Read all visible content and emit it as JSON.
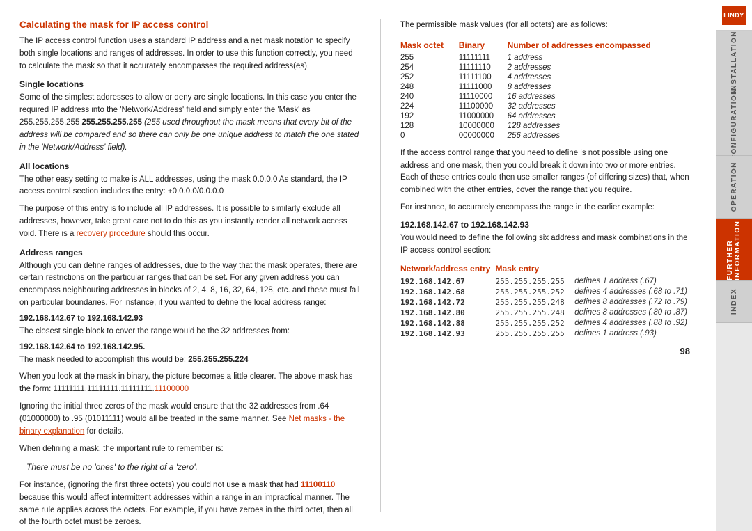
{
  "page": {
    "title": "Calculating the mask for IP access control",
    "number": "98"
  },
  "intro_paragraph": "The IP access control function uses a standard IP address and a net mask notation to specify both single locations and ranges of addresses. In order to use this function correctly, you need to calculate the mask so that it accurately encompasses the required address(es).",
  "sections": {
    "single_locations": {
      "heading": "Single locations",
      "text1": "Some of the simplest addresses to allow or deny are single locations. In this case you enter the required IP address into the 'Network/Address' field and simply enter the 'Mask' as 255.255.255.255",
      "text1_italic": "(255 used throughout the mask means that every bit of the address will be compared and so there can only be one unique address to match the one stated in the 'Network/Address' field).",
      "bold_code": "255.255.255.255"
    },
    "all_locations": {
      "heading": "All locations",
      "text1": "The other easy setting to make is ALL addresses, using the mask 0.0.0.0  As standard, the IP access control section includes the entry: +0.0.0.0/0.0.0.0",
      "text2": "The purpose of this entry is to include all IP addresses. It is possible to similarly exclude all addresses, however, take great care not to do this as you instantly render all network access void. There is a",
      "link_text": "recovery procedure",
      "text3": " should this occur.",
      "bold_entry": "+0.0.0.0/0.0.0.0"
    },
    "address_ranges": {
      "heading": "Address ranges",
      "text1": "Although you can define ranges of addresses, due to the way that the mask operates, there are certain restrictions on the particular ranges that can be set. For any given address you can encompass neighbouring addresses in blocks of 2, 4, 8, 16, 32, 64, 128, etc. and these must fall on particular boundaries. For instance, if you wanted to define the local address range:",
      "bold_range1": "192.168.142.67 to 192.168.142.93",
      "text2": "The closest single block to cover the range would be the 32 addresses from:",
      "bold_range2": "192.168.142.64 to 192.168.142.95.",
      "text3": "The mask needed to accomplish this would be: 255.255.255.224",
      "bold_mask": "255.255.255.224",
      "text4": "When you look at the mask in binary, the picture becomes a little clearer. The above mask has the form: 11111111.11111111.11111111.",
      "binary_suffix": "11100000",
      "text5": "Ignoring the initial three zeros of the mask would ensure that the 32 addresses from .64 (01000000) to .95 (01011111) would all be treated in the same manner. See",
      "link_text2": "Net masks - the binary explanation",
      "text6": " for details.",
      "text7": "When defining a mask, the important rule to remember is:",
      "rule": "There must be no 'ones' to the right of a 'zero'.",
      "text8": "For instance, (ignoring the first three octets) you could not use a mask that had",
      "bad_binary": "11100110",
      "text9": " because this would affect intermittent addresses within a range in an impractical manner. The same rule applies across the octets. For example, if you have zeroes in the third octet, then all of the fourth octet must be zeroes."
    }
  },
  "right_panel": {
    "permissible_intro": "The permissible mask values (for all octets) are as follows:",
    "mask_table": {
      "headers": [
        "Mask octet",
        "Binary",
        "Number of addresses encompassed"
      ],
      "rows": [
        {
          "octet": "255",
          "binary": "11111111",
          "addresses": "1 address"
        },
        {
          "octet": "254",
          "binary": "11111110",
          "addresses": "2 addresses"
        },
        {
          "octet": "252",
          "binary": "11111100",
          "addresses": "4 addresses"
        },
        {
          "octet": "248",
          "binary": "11111000",
          "addresses": "8 addresses"
        },
        {
          "octet": "240",
          "binary": "11110000",
          "addresses": "16 addresses"
        },
        {
          "octet": "224",
          "binary": "11100000",
          "addresses": "32 addresses"
        },
        {
          "octet": "192",
          "binary": "11000000",
          "addresses": "64 addresses"
        },
        {
          "octet": "128",
          "binary": "10000000",
          "addresses": "128 addresses"
        },
        {
          "octet": "0",
          "binary": "00000000",
          "addresses": "256 addresses"
        }
      ]
    },
    "explanation1": "If the access control range that you need to define is not possible using one address and one mask, then you could break it down into two or more entries. Each of these entries could then use smaller ranges (of differing sizes) that, when combined with the other entries, cover the range that you require.",
    "explanation2": "For instance, to accurately encompass the range in the earlier example:",
    "range_example": "192.168.142.67 to 192.168.142.93",
    "explanation3": "You would need to define the following six address and mask combinations in the IP access control section:",
    "network_table": {
      "headers": [
        "Network/address entry",
        "Mask entry"
      ],
      "rows": [
        {
          "network": "192.168.142.67",
          "mask": "255.255.255.255",
          "note": "defines 1 address (.67)"
        },
        {
          "network": "192.168.142.68",
          "mask": "255.255.255.252",
          "note": "defines 4 addresses (.68 to .71)"
        },
        {
          "network": "192.168.142.72",
          "mask": "255.255.255.248",
          "note": "defines 8 addresses (.72 to .79)"
        },
        {
          "network": "192.168.142.80",
          "mask": "255.255.255.248",
          "note": "defines 8 addresses (.80 to .87)"
        },
        {
          "network": "192.168.142.88",
          "mask": "255.255.255.252",
          "note": "defines 4 addresses (.88 to .92)"
        },
        {
          "network": "192.168.142.93",
          "mask": "255.255.255.255",
          "note": "defines 1 address (.93)"
        }
      ]
    }
  },
  "sidebar": {
    "logo_text": "LINDY",
    "tabs": [
      {
        "label": "INSTALLATION",
        "active": false
      },
      {
        "label": "CONFIGURATION",
        "active": false
      },
      {
        "label": "OPERATION",
        "active": false
      },
      {
        "label": "FURTHER INFORMATION",
        "active": true
      }
    ],
    "index_label": "INDEX"
  }
}
